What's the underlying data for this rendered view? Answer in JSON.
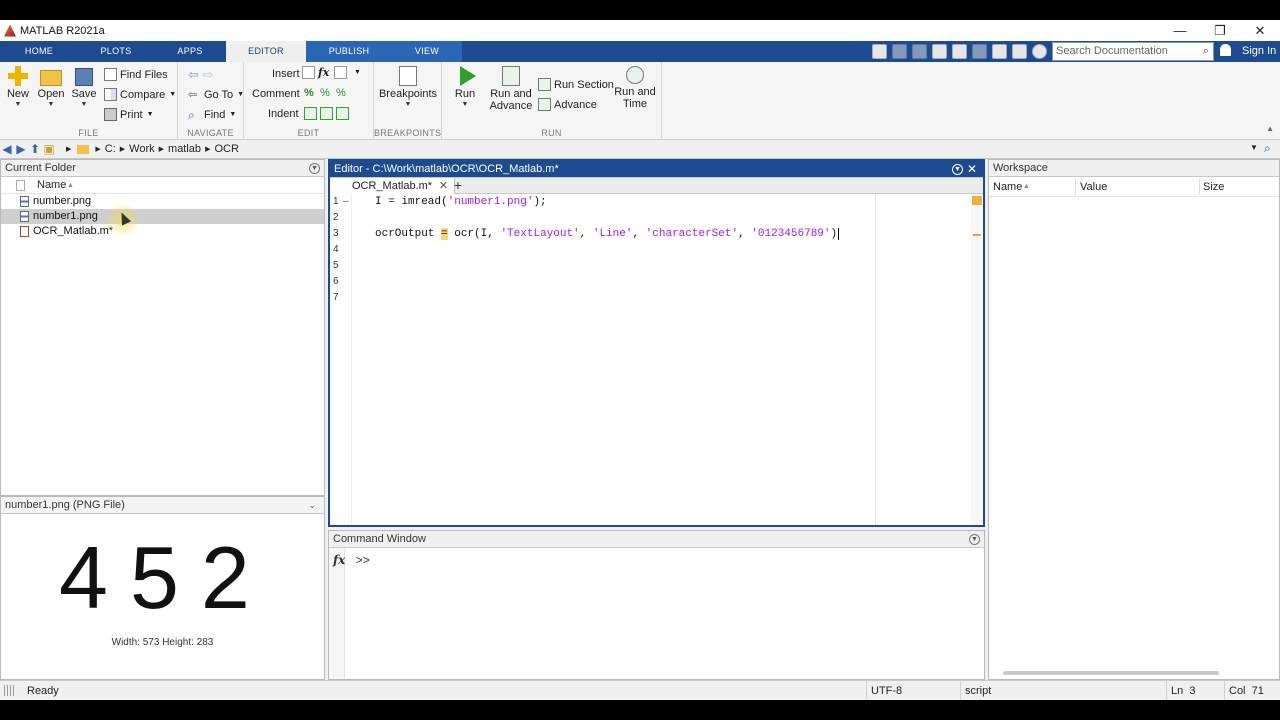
{
  "window": {
    "title": "MATLAB R2021a"
  },
  "tabs": [
    {
      "label": "HOME"
    },
    {
      "label": "PLOTS"
    },
    {
      "label": "APPS"
    },
    {
      "label": "EDITOR"
    },
    {
      "label": "PUBLISH"
    },
    {
      "label": "VIEW"
    }
  ],
  "active_tab": "EDITOR",
  "search": {
    "placeholder": "Search Documentation"
  },
  "sign_in": "Sign In",
  "ribbon": {
    "file": {
      "label": "FILE",
      "new": "New",
      "open": "Open",
      "save": "Save",
      "find_files": "Find Files",
      "compare": "Compare",
      "print": "Print"
    },
    "navigate": {
      "label": "NAVIGATE",
      "go_to": "Go To",
      "find": "Find"
    },
    "edit": {
      "label": "EDIT",
      "insert": "Insert",
      "comment": "Comment",
      "indent": "Indent"
    },
    "breakpoints": {
      "label": "BREAKPOINTS",
      "breakpoints": "Breakpoints"
    },
    "run": {
      "label": "RUN",
      "run": "Run",
      "run_and": "Run and",
      "advance_word": "Advance",
      "run_section": "Run Section",
      "advance": "Advance",
      "run_and_time_1": "Run and",
      "run_and_time_2": "Time"
    }
  },
  "address": {
    "path": [
      "C:",
      "Work",
      "matlab",
      "OCR"
    ]
  },
  "current_folder": {
    "title": "Current Folder",
    "column": "Name",
    "files": [
      {
        "name": "number.png",
        "type": "img",
        "selected": false
      },
      {
        "name": "number1.png",
        "type": "img",
        "selected": true
      },
      {
        "name": "OCR_Matlab.m*",
        "type": "m",
        "selected": false
      }
    ]
  },
  "details": {
    "title": "number1.png  (PNG File)",
    "preview_text": "452",
    "dimensions": "Width: 573 Height: 283"
  },
  "editor": {
    "title": "Editor - C:\\Work\\matlab\\OCR\\OCR_Matlab.m*",
    "tab": "OCR_Matlab.m*",
    "add_tab": "+",
    "line_numbers": [
      "1",
      "2",
      "3",
      "4",
      "5",
      "6",
      "7"
    ],
    "code": {
      "l1_pre": "I = imread(",
      "l1_str": "'number1.png'",
      "l1_post": ");",
      "l3_a": "ocrOutput ",
      "l3_eq": "=",
      "l3_b": " ocr(I, ",
      "l3_s1": "'TextLayout'",
      "l3_c1": ", ",
      "l3_s2": "'Line'",
      "l3_c2": ", ",
      "l3_s3": "'characterSet'",
      "l3_c3": ", ",
      "l3_s4": "'0123456789'",
      "l3_end": ")"
    }
  },
  "command_window": {
    "title": "Command Window",
    "fx": "fx",
    "prompt": ">>"
  },
  "workspace": {
    "title": "Workspace",
    "columns": [
      "Name",
      "Value",
      "Size"
    ]
  },
  "status": {
    "state": "Ready",
    "encoding": "UTF-8",
    "filetype": "script",
    "ln_label": "Ln",
    "ln": "3",
    "col_label": "Col",
    "col": "71"
  },
  "colors": {
    "accent": "#1d4b8f",
    "string": "#a020f0",
    "highlight": "#f5d87a"
  }
}
